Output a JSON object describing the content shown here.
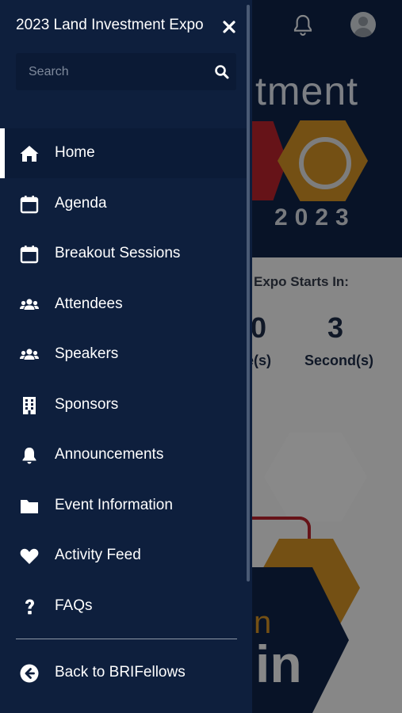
{
  "drawer": {
    "title": "2023 Land Investment Expo",
    "search_placeholder": "Search",
    "items": [
      {
        "label": "Home",
        "icon": "home-icon",
        "active": true
      },
      {
        "label": "Agenda",
        "icon": "calendar-icon"
      },
      {
        "label": "Breakout Sessions",
        "icon": "calendar-icon"
      },
      {
        "label": "Attendees",
        "icon": "users-icon"
      },
      {
        "label": "Speakers",
        "icon": "users-icon"
      },
      {
        "label": "Sponsors",
        "icon": "building-icon"
      },
      {
        "label": "Announcements",
        "icon": "bell-icon"
      },
      {
        "label": "Event Information",
        "icon": "folder-icon"
      },
      {
        "label": "Activity Feed",
        "icon": "heart-icon"
      },
      {
        "label": "FAQs",
        "icon": "question-icon"
      }
    ],
    "back_label": "Back to BRIFellows"
  },
  "background": {
    "logo_fragment": "tment",
    "year": "2023",
    "countdown_heading": "Expo Starts In:",
    "countdown_value_partial": "0",
    "countdown_label_partial": "e(s)",
    "seconds_value": "3",
    "seconds_label": "Second(s)",
    "promo_fragment_n": "n",
    "promo_fragment_in": "in"
  },
  "colors": {
    "drawer_bg": "#0e1f3d",
    "accent_gold": "#c98a24",
    "accent_red": "#b0222a"
  }
}
